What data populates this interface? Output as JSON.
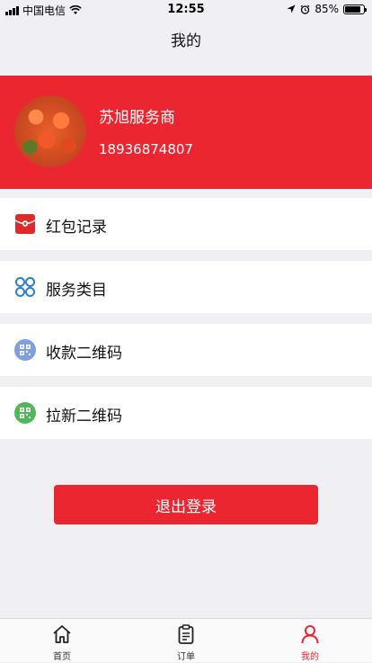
{
  "statusbar": {
    "carrier": "中国电信",
    "time": "12:55",
    "battery": "85%",
    "battery_level": 0.85
  },
  "navbar": {
    "title": "我的"
  },
  "profile": {
    "name": "苏旭服务商",
    "phone": "18936874807"
  },
  "menu": [
    {
      "label": "红包记录",
      "icon": "red-envelope-icon",
      "color": "#e02a2a"
    },
    {
      "label": "服务类目",
      "icon": "clover-grid-icon",
      "color": "#2d7fc8"
    },
    {
      "label": "收款二维码",
      "icon": "qr-code-icon",
      "color": "#7f9ee0"
    },
    {
      "label": "拉新二维码",
      "icon": "qr-code-icon",
      "color": "#52b65a"
    }
  ],
  "logout": {
    "label": "退出登录"
  },
  "tabbar": [
    {
      "label": "首页",
      "icon": "home-icon",
      "active": false
    },
    {
      "label": "订单",
      "icon": "clipboard-icon",
      "active": false
    },
    {
      "label": "我的",
      "icon": "user-icon",
      "active": true
    }
  ],
  "colors": {
    "accent": "#ec2630",
    "background": "#efeff4"
  }
}
